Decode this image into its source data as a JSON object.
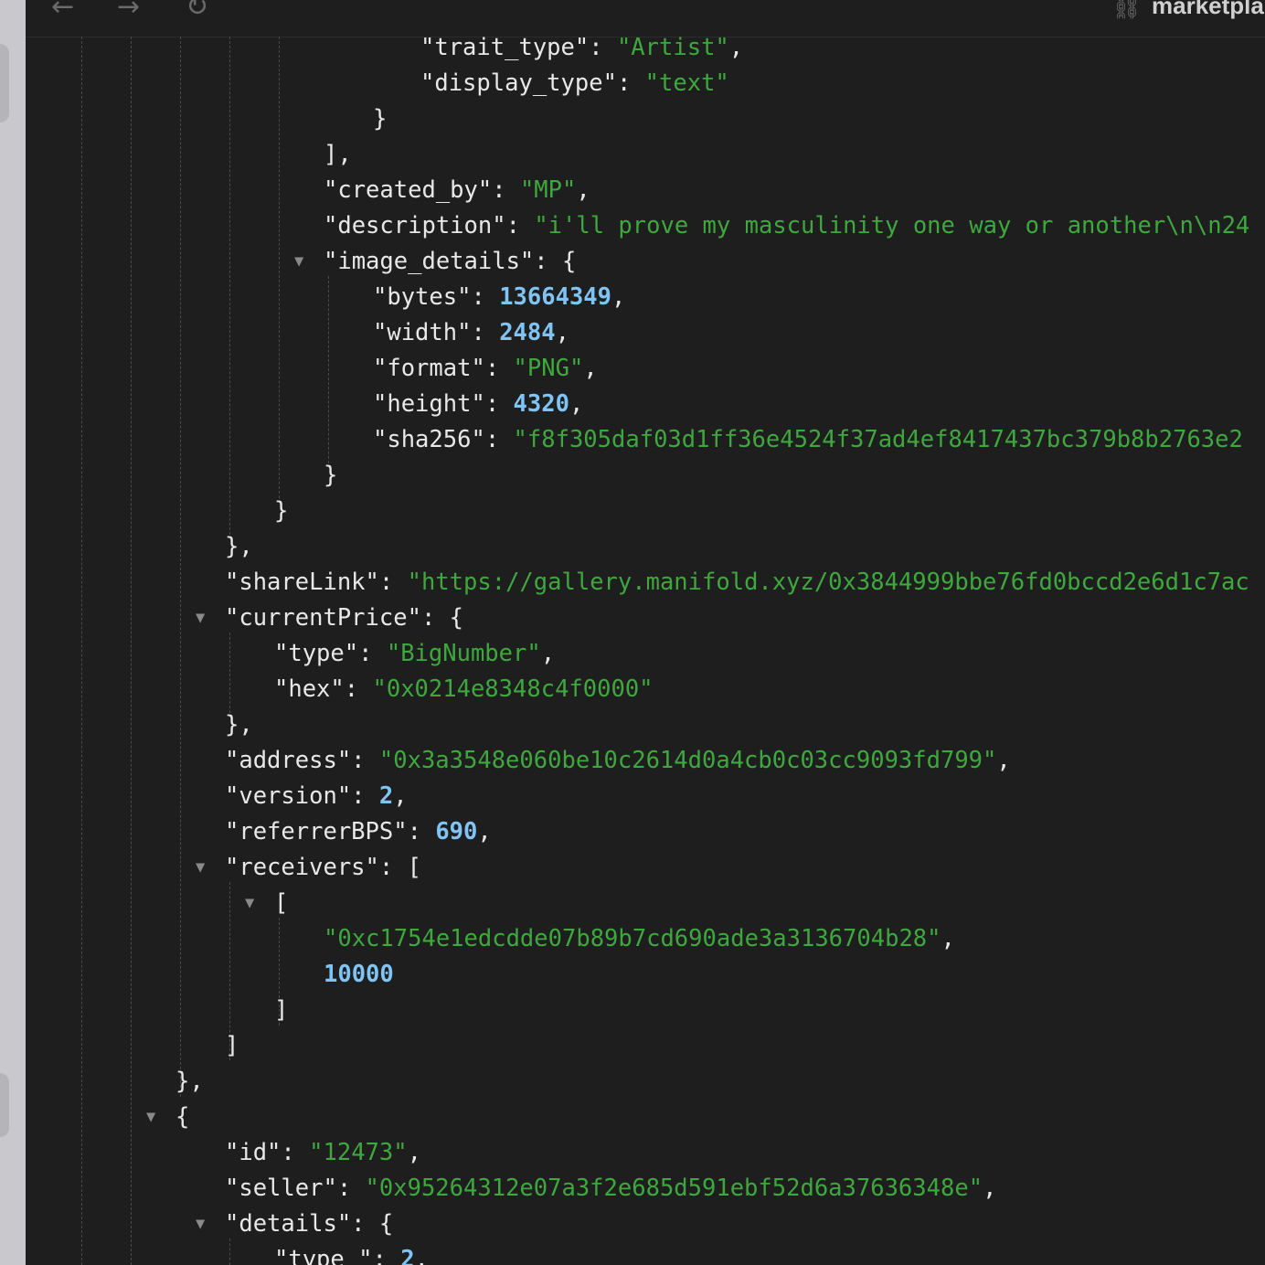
{
  "toolbar": {
    "back_icon": "arrow-left-icon",
    "forward_icon": "arrow-right-icon",
    "reload_icon": "reload-icon",
    "link_icon": "link-icon",
    "site": "marketpla"
  },
  "json_lines": [
    {
      "k": "\"trait_type\"",
      "sep": ": ",
      "v": "\"Artist\"",
      "vt": "s",
      "end": ","
    },
    {
      "k": "\"display_type\"",
      "sep": ": ",
      "v": "\"text\"",
      "vt": "s",
      "end": ""
    },
    {
      "p": "}"
    },
    {
      "p": "],"
    },
    {
      "k": "\"created_by\"",
      "sep": ": ",
      "v": "\"MP\"",
      "vt": "s",
      "end": ","
    },
    {
      "k": "\"description\"",
      "sep": ": ",
      "v": "\"i'll prove my masculinity one way or another\\n\\n24",
      "vt": "s",
      "end": ""
    },
    {
      "k": "\"image_details\"",
      "sep": ": ",
      "p2": "{",
      "toggle": true
    },
    {
      "k": "\"bytes\"",
      "sep": ": ",
      "v": "13664349",
      "vt": "n",
      "end": ","
    },
    {
      "k": "\"width\"",
      "sep": ": ",
      "v": "2484",
      "vt": "n",
      "end": ","
    },
    {
      "k": "\"format\"",
      "sep": ": ",
      "v": "\"PNG\"",
      "vt": "s",
      "end": ","
    },
    {
      "k": "\"height\"",
      "sep": ": ",
      "v": "4320",
      "vt": "n",
      "end": ","
    },
    {
      "k": "\"sha256\"",
      "sep": ": ",
      "v": "\"f8f305daf03d1ff36e4524f37ad4ef8417437bc379b8b2763e2",
      "vt": "s",
      "end": ""
    },
    {
      "p": "}"
    },
    {
      "p": "}"
    },
    {
      "p": "},"
    },
    {
      "k": "\"shareLink\"",
      "sep": ": ",
      "v": "\"https://gallery.manifold.xyz/0x3844999bbe76fd0bccd2e6d1c7ac",
      "vt": "s",
      "end": ""
    },
    {
      "k": "\"currentPrice\"",
      "sep": ": ",
      "p2": "{",
      "toggle": true
    },
    {
      "k": "\"type\"",
      "sep": ": ",
      "v": "\"BigNumber\"",
      "vt": "s",
      "end": ","
    },
    {
      "k": "\"hex\"",
      "sep": ": ",
      "v": "\"0x0214e8348c4f0000\"",
      "vt": "s",
      "end": ""
    },
    {
      "p": "},"
    },
    {
      "k": "\"address\"",
      "sep": ": ",
      "v": "\"0x3a3548e060be10c2614d0a4cb0c03cc9093fd799\"",
      "vt": "s",
      "end": ","
    },
    {
      "k": "\"version\"",
      "sep": ": ",
      "v": "2",
      "vt": "n",
      "end": ","
    },
    {
      "k": "\"referrerBPS\"",
      "sep": ": ",
      "v": "690",
      "vt": "n",
      "end": ","
    },
    {
      "k": "\"receivers\"",
      "sep": ": ",
      "p2": "[",
      "toggle": true
    },
    {
      "p": "[",
      "toggle": true
    },
    {
      "v": "\"0xc1754e1edcdde07b89b7cd690ade3a3136704b28\"",
      "vt": "s",
      "end": ","
    },
    {
      "v": "10000",
      "vt": "n",
      "end": ""
    },
    {
      "p": "]"
    },
    {
      "p": "]"
    },
    {
      "p": "},"
    },
    {
      "p": "{",
      "toggle": true
    },
    {
      "k": "\"id\"",
      "sep": ": ",
      "v": "\"12473\"",
      "vt": "s",
      "end": ","
    },
    {
      "k": "\"seller\"",
      "sep": ": ",
      "v": "\"0x95264312e07a3f2e685d591ebf52d6a37636348e\"",
      "vt": "s",
      "end": ","
    },
    {
      "k": "\"details\"",
      "sep": ": ",
      "p2": "{",
      "toggle": true
    },
    {
      "k": "\"type_\"",
      "sep": ": ",
      "v": "2",
      "vt": "n",
      "end": ","
    }
  ]
}
